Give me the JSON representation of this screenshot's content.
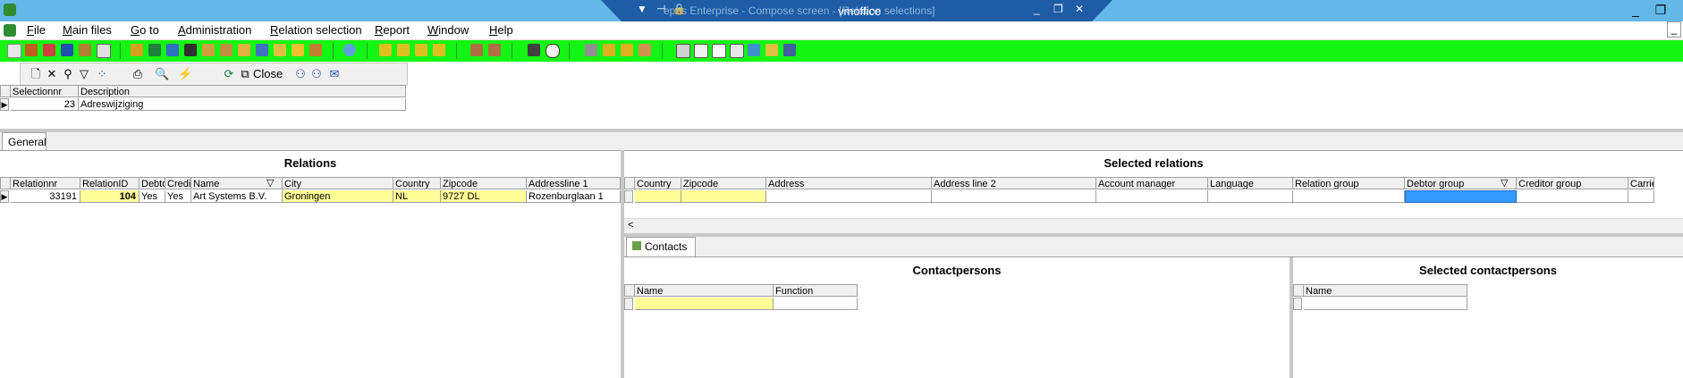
{
  "window": {
    "title_text": "epas Enterprise - Compose screen - [Relation selections]",
    "remote_label": "vmoffice",
    "app_min": "_",
    "app_restore": "❐",
    "doc_min": "_"
  },
  "menu": [
    "File",
    "Main files",
    "Go to",
    "Administration",
    "Relation selection",
    "Report",
    "Window",
    "Help"
  ],
  "toolbar2": {
    "close_label": "Close"
  },
  "selection_grid": {
    "headers": [
      "Selectionnr",
      "Description"
    ],
    "row": [
      "23",
      "Adreswijziging"
    ]
  },
  "tabs": {
    "general": "General",
    "contacts": "Contacts"
  },
  "relations": {
    "title": "Relations",
    "headers": [
      "Relationnr",
      "RelationID",
      "Debto",
      "Credi",
      "Name",
      "City",
      "Country",
      "Zipcode",
      "Addressline 1"
    ],
    "row": [
      "33191",
      "104",
      "Yes",
      "Yes",
      "Art Systems B.V.",
      "Groningen",
      "NL",
      "9727 DL",
      "Rozenburglaan 1"
    ]
  },
  "selected_relations": {
    "title": "Selected relations",
    "headers": [
      "Country",
      "Zipcode",
      "Address",
      "Address line 2",
      "Account manager",
      "Language",
      "Relation group",
      "Debtor group",
      "Creditor group",
      "Carrie"
    ],
    "scroll_left": "<"
  },
  "contactpersons": {
    "title": "Contactpersons",
    "headers": [
      "Name",
      "Function"
    ]
  },
  "selected_contactpersons": {
    "title": "Selected contactpersons",
    "headers": [
      "Name"
    ]
  },
  "colors": {
    "titlebar": "#63b8e8",
    "toolbar": "#14f514",
    "highlight": "#ffff99",
    "selected": "#3399ff"
  }
}
